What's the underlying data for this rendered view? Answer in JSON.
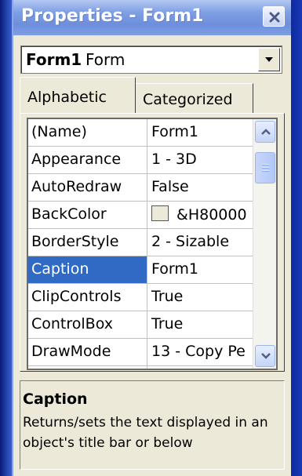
{
  "window": {
    "title": "Properties - Form1"
  },
  "object_selector": {
    "name": "Form1",
    "type": "Form"
  },
  "tabs": [
    {
      "label": "Alphabetic",
      "active": true
    },
    {
      "label": "Categorized",
      "active": false
    }
  ],
  "properties": [
    {
      "name": "(Name)",
      "value": "Form1"
    },
    {
      "name": "Appearance",
      "value": "1 - 3D"
    },
    {
      "name": "AutoRedraw",
      "value": "False"
    },
    {
      "name": "BackColor",
      "value": "&H80000"
    },
    {
      "name": "BorderStyle",
      "value": "2 - Sizable"
    },
    {
      "name": "Caption",
      "value": "Form1",
      "selected": true
    },
    {
      "name": "ClipControls",
      "value": "True"
    },
    {
      "name": "ControlBox",
      "value": "True"
    },
    {
      "name": "DrawMode",
      "value": "13 - Copy Pe"
    }
  ],
  "description": {
    "title": "Caption",
    "text": "Returns/sets the text displayed in an object's title bar or below"
  },
  "colors": {
    "selection": "#316ac5",
    "titlebar": "#7f9fe4",
    "window_bg": "#ece9d8",
    "backcolor_swatch": "#ece9d8"
  }
}
